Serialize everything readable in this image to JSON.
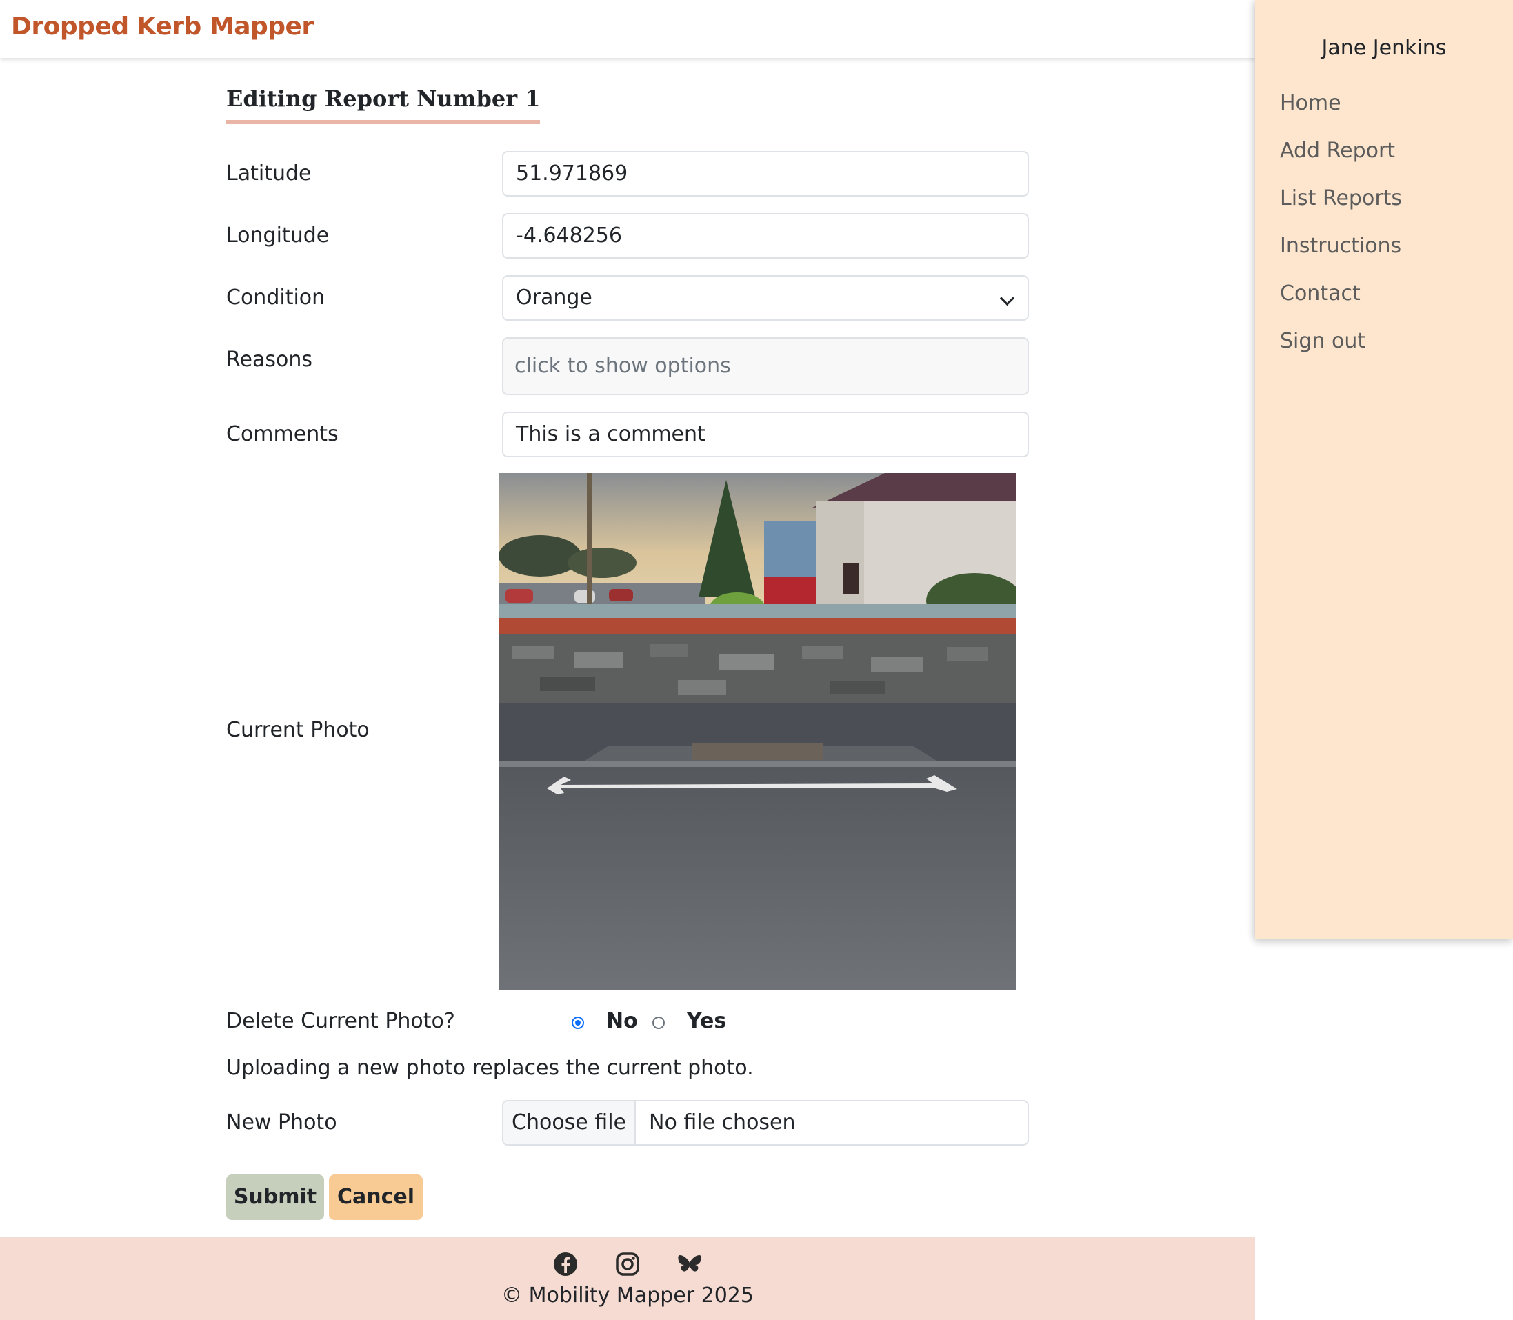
{
  "navbar": {
    "brand": "Dropped Kerb Mapper"
  },
  "sidebar": {
    "user_name": "Jane Jenkins",
    "items": [
      {
        "label": "Home"
      },
      {
        "label": "Add Report"
      },
      {
        "label": "List Reports"
      },
      {
        "label": "Instructions"
      },
      {
        "label": "Contact"
      },
      {
        "label": "Sign out"
      }
    ]
  },
  "form": {
    "title": "Editing Report Number 1",
    "latitude": {
      "label": "Latitude",
      "value": "51.971869"
    },
    "longitude": {
      "label": "Longitude",
      "value": "-4.648256"
    },
    "condition": {
      "label": "Condition",
      "value": "Orange"
    },
    "reasons": {
      "label": "Reasons",
      "placeholder": "click to show options"
    },
    "comments": {
      "label": "Comments",
      "value": "This is a comment"
    },
    "current_photo": {
      "label": "Current Photo"
    },
    "delete_photo": {
      "label": "Delete Current Photo?",
      "options": [
        {
          "label": "No",
          "checked": true
        },
        {
          "label": "Yes",
          "checked": false
        }
      ]
    },
    "upload_note": "Uploading a new photo replaces the current photo.",
    "new_photo": {
      "label": "New Photo",
      "button": "Choose file",
      "status": "No file chosen"
    },
    "submit_label": "Submit",
    "cancel_label": "Cancel"
  },
  "footer": {
    "icons": [
      "facebook-icon",
      "instagram-icon",
      "bluesky-icon"
    ],
    "copyright": "© Mobility Mapper 2025"
  },
  "colors": {
    "brand": "#c0562a",
    "sidebar_bg": "#fde6cd",
    "footer_bg": "#f5dbd1",
    "submit_bg": "#c6cfbc",
    "cancel_bg": "#f8cb94",
    "title_underline": "#e9b5a6"
  }
}
